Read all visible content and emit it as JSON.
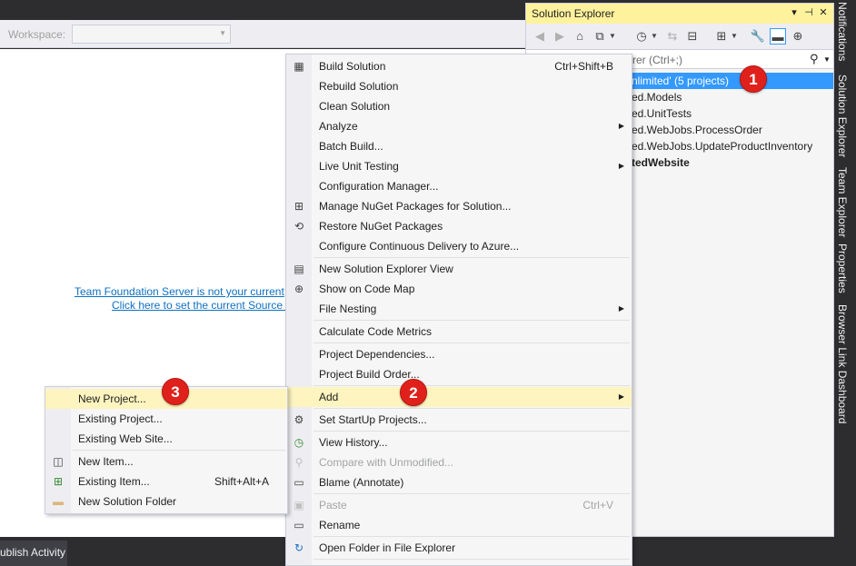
{
  "workspace": {
    "label": "Workspace:"
  },
  "tfs_message": {
    "line1": "Team Foundation Server is not your current",
    "line2": "Click here to set the current Source C"
  },
  "solution_explorer": {
    "title": "Solution Explorer",
    "search_placeholder": "rer (Ctrl+;)",
    "tree": [
      {
        "label": "nlimited' (5 projects)",
        "selected": true
      },
      {
        "label": "ed.Models"
      },
      {
        "label": "ed.UnitTests"
      },
      {
        "label": "ed.WebJobs.ProcessOrder"
      },
      {
        "label": "ed.WebJobs.UpdateProductInventory"
      },
      {
        "label": "tedWebsite",
        "bold": true
      }
    ]
  },
  "side_tabs": [
    "Notifications",
    "Solution Explorer",
    "Team Explorer",
    "Properties",
    "Browser Link Dashboard"
  ],
  "bottom_bar": {
    "tab": "ublish Activity"
  },
  "context_menu": {
    "items": [
      {
        "label": "Build Solution",
        "shortcut": "Ctrl+Shift+B",
        "icon": "build-icon"
      },
      {
        "label": "Rebuild Solution"
      },
      {
        "label": "Clean Solution"
      },
      {
        "label": "Analyze",
        "submenu": true
      },
      {
        "label": "Batch Build..."
      },
      {
        "label": "Live Unit Testing",
        "submenu": true
      },
      {
        "label": "Configuration Manager..."
      },
      {
        "label": "Manage NuGet Packages for Solution...",
        "icon": "nuget-icon"
      },
      {
        "label": "Restore NuGet Packages",
        "icon": "restore-icon"
      },
      {
        "label": "Configure Continuous Delivery to Azure..."
      },
      {
        "label": "New Solution Explorer View",
        "icon": "new-view-icon"
      },
      {
        "label": "Show on Code Map",
        "icon": "code-map-icon"
      },
      {
        "label": "File Nesting",
        "submenu": true
      },
      {
        "label": "Calculate Code Metrics"
      },
      {
        "label": "Project Dependencies..."
      },
      {
        "label": "Project Build Order..."
      },
      {
        "label": "Add",
        "submenu": true,
        "highlighted": true
      },
      {
        "label": "Set StartUp Projects...",
        "icon": "gear-icon"
      },
      {
        "label": "View History...",
        "icon": "history-icon"
      },
      {
        "label": "Compare with Unmodified...",
        "disabled": true,
        "icon": "compare-icon"
      },
      {
        "label": "Blame (Annotate)",
        "icon": "annotate-icon"
      },
      {
        "label": "Paste",
        "shortcut": "Ctrl+V",
        "disabled": true,
        "icon": "paste-icon"
      },
      {
        "label": "Rename",
        "icon": "rename-icon"
      },
      {
        "label": "Open Folder in File Explorer",
        "icon": "open-folder-icon"
      }
    ]
  },
  "add_submenu": {
    "items": [
      {
        "label": "New Project...",
        "highlighted": true
      },
      {
        "label": "Existing Project..."
      },
      {
        "label": "Existing Web Site..."
      },
      {
        "label": "New Item...",
        "icon": "new-item-icon"
      },
      {
        "label": "Existing Item...",
        "shortcut": "Shift+Alt+A",
        "icon": "existing-item-icon"
      },
      {
        "label": "New Solution Folder",
        "icon": "solution-folder-icon"
      }
    ]
  },
  "callouts": [
    "1",
    "2",
    "3"
  ],
  "colors": {
    "accent": "#3399ff",
    "highlight": "#fdf4bf",
    "title_active": "#fff29d",
    "callout": "#e0211b"
  }
}
